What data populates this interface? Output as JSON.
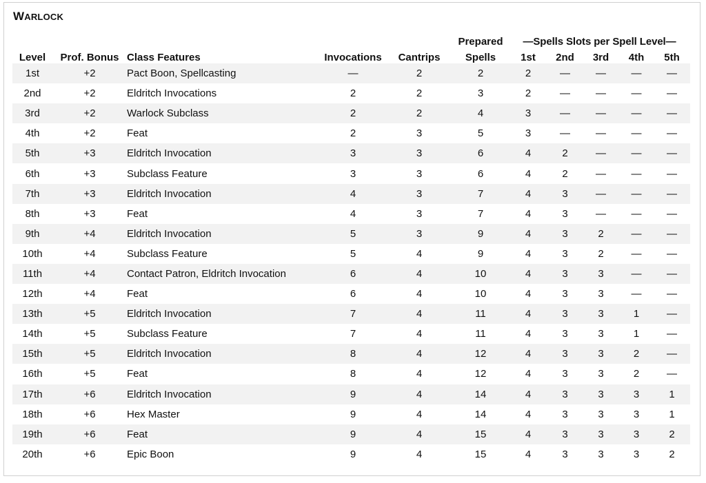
{
  "title": {
    "first_letter": "W",
    "rest": "ARLOCK",
    "full": "Warlock"
  },
  "header": {
    "prepared_top": "Prepared",
    "spell_slots_group": "—Spells  Slots per Spell Level—",
    "columns": [
      "Level",
      "Prof. Bonus",
      "Class Features",
      "Invocations",
      "Cantrips",
      "Spells",
      "1st",
      "2nd",
      "3rd",
      "4th",
      "5th"
    ]
  },
  "rows": [
    [
      "1st",
      "+2",
      "Pact Boon, Spellcasting",
      "—",
      "2",
      "2",
      "2",
      "—",
      "—",
      "—",
      "—"
    ],
    [
      "2nd",
      "+2",
      "Eldritch Invocations",
      "2",
      "2",
      "3",
      "2",
      "—",
      "—",
      "—",
      "—"
    ],
    [
      "3rd",
      "+2",
      "Warlock Subclass",
      "2",
      "2",
      "4",
      "3",
      "—",
      "—",
      "—",
      "—"
    ],
    [
      "4th",
      "+2",
      "Feat",
      "2",
      "3",
      "5",
      "3",
      "—",
      "—",
      "—",
      "—"
    ],
    [
      "5th",
      "+3",
      "Eldritch Invocation",
      "3",
      "3",
      "6",
      "4",
      "2",
      "—",
      "—",
      "—"
    ],
    [
      "6th",
      "+3",
      "Subclass Feature",
      "3",
      "3",
      "6",
      "4",
      "2",
      "—",
      "—",
      "—"
    ],
    [
      "7th",
      "+3",
      "Eldritch Invocation",
      "4",
      "3",
      "7",
      "4",
      "3",
      "—",
      "—",
      "—"
    ],
    [
      "8th",
      "+3",
      "Feat",
      "4",
      "3",
      "7",
      "4",
      "3",
      "—",
      "—",
      "—"
    ],
    [
      "9th",
      "+4",
      "Eldritch Invocation",
      "5",
      "3",
      "9",
      "4",
      "3",
      "2",
      "—",
      "—"
    ],
    [
      "10th",
      "+4",
      "Subclass Feature",
      "5",
      "4",
      "9",
      "4",
      "3",
      "2",
      "—",
      "—"
    ],
    [
      "11th",
      "+4",
      "Contact Patron, Eldritch Invocation",
      "6",
      "4",
      "10",
      "4",
      "3",
      "3",
      "—",
      "—"
    ],
    [
      "12th",
      "+4",
      "Feat",
      "6",
      "4",
      "10",
      "4",
      "3",
      "3",
      "—",
      "—"
    ],
    [
      "13th",
      "+5",
      "Eldritch Invocation",
      "7",
      "4",
      "11",
      "4",
      "3",
      "3",
      "1",
      "—"
    ],
    [
      "14th",
      "+5",
      "Subclass Feature",
      "7",
      "4",
      "11",
      "4",
      "3",
      "3",
      "1",
      "—"
    ],
    [
      "15th",
      "+5",
      "Eldritch Invocation",
      "8",
      "4",
      "12",
      "4",
      "3",
      "3",
      "2",
      "—"
    ],
    [
      "16th",
      "+5",
      "Feat",
      "8",
      "4",
      "12",
      "4",
      "3",
      "3",
      "2",
      "—"
    ],
    [
      "17th",
      "+6",
      "Eldritch Invocation",
      "9",
      "4",
      "14",
      "4",
      "3",
      "3",
      "3",
      "1"
    ],
    [
      "18th",
      "+6",
      "Hex Master",
      "9",
      "4",
      "14",
      "4",
      "3",
      "3",
      "3",
      "1"
    ],
    [
      "19th",
      "+6",
      "Feat",
      "9",
      "4",
      "15",
      "4",
      "3",
      "3",
      "3",
      "2"
    ],
    [
      "20th",
      "+6",
      "Epic Boon",
      "9",
      "4",
      "15",
      "4",
      "3",
      "3",
      "3",
      "2"
    ]
  ],
  "colors": {
    "stripe": "#f2f2f2",
    "border": "#cfcfcf",
    "text": "#111111"
  }
}
